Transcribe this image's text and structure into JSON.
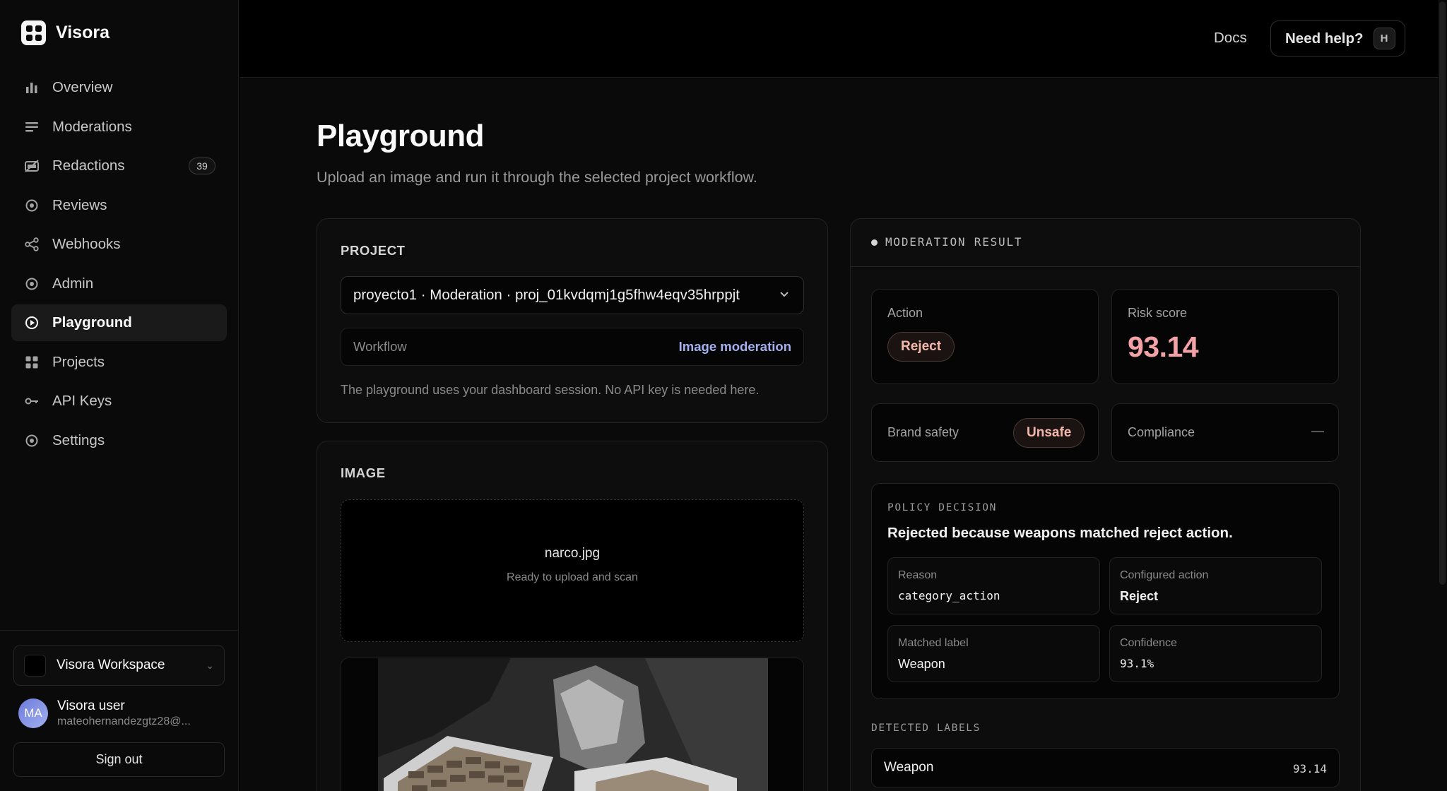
{
  "app": {
    "name": "Visora"
  },
  "sidebar": {
    "items": [
      {
        "label": "Overview",
        "icon": "bar-chart-icon"
      },
      {
        "label": "Moderations",
        "icon": "list-icon"
      },
      {
        "label": "Redactions",
        "icon": "redaction-icon",
        "badge": "39"
      },
      {
        "label": "Reviews",
        "icon": "target-icon"
      },
      {
        "label": "Webhooks",
        "icon": "share-icon"
      },
      {
        "label": "Admin",
        "icon": "target-icon"
      },
      {
        "label": "Playground",
        "icon": "play-circle-icon",
        "active": true
      },
      {
        "label": "Projects",
        "icon": "grid-icon"
      },
      {
        "label": "API Keys",
        "icon": "key-icon"
      },
      {
        "label": "Settings",
        "icon": "target-icon"
      }
    ],
    "workspace": "Visora Workspace",
    "user": {
      "initials": "MA",
      "name": "Visora user",
      "email": "mateohernandezgtz28@..."
    },
    "sign_out": "Sign out"
  },
  "header": {
    "docs": "Docs",
    "help": "Need help?",
    "help_key": "H"
  },
  "page": {
    "title": "Playground",
    "subtitle": "Upload an image and run it through the selected project workflow."
  },
  "project": {
    "section": "PROJECT",
    "selected": "proyecto1 · Moderation · proj_01kvdqmj1g5fhw4eqv35hrppjt",
    "workflow_label": "Workflow",
    "workflow_value": "Image moderation",
    "note": "The playground uses your dashboard session. No API key is needed here."
  },
  "image": {
    "section": "IMAGE",
    "filename": "narco.jpg",
    "status": "Ready to upload and scan"
  },
  "result": {
    "title": "MODERATION RESULT",
    "action_label": "Action",
    "action": "Reject",
    "risk_label": "Risk score",
    "risk": "93.14",
    "brand_label": "Brand safety",
    "brand": "Unsafe",
    "compliance_label": "Compliance",
    "compliance": "—",
    "policy_title": "POLICY DECISION",
    "policy_text": "Rejected because weapons matched reject action.",
    "reason_label": "Reason",
    "reason": "category_action",
    "configured_label": "Configured action",
    "configured": "Reject",
    "matched_label": "Matched label",
    "matched": "Weapon",
    "confidence_label": "Confidence",
    "confidence": "93.1%",
    "detected_title": "DETECTED LABELS",
    "labels": [
      {
        "name": "Weapon",
        "score": "93.14"
      }
    ]
  },
  "colors": {
    "accent": "#a3b0f2",
    "danger": "#f2a1a6",
    "pill_text": "#f4b8aa"
  }
}
